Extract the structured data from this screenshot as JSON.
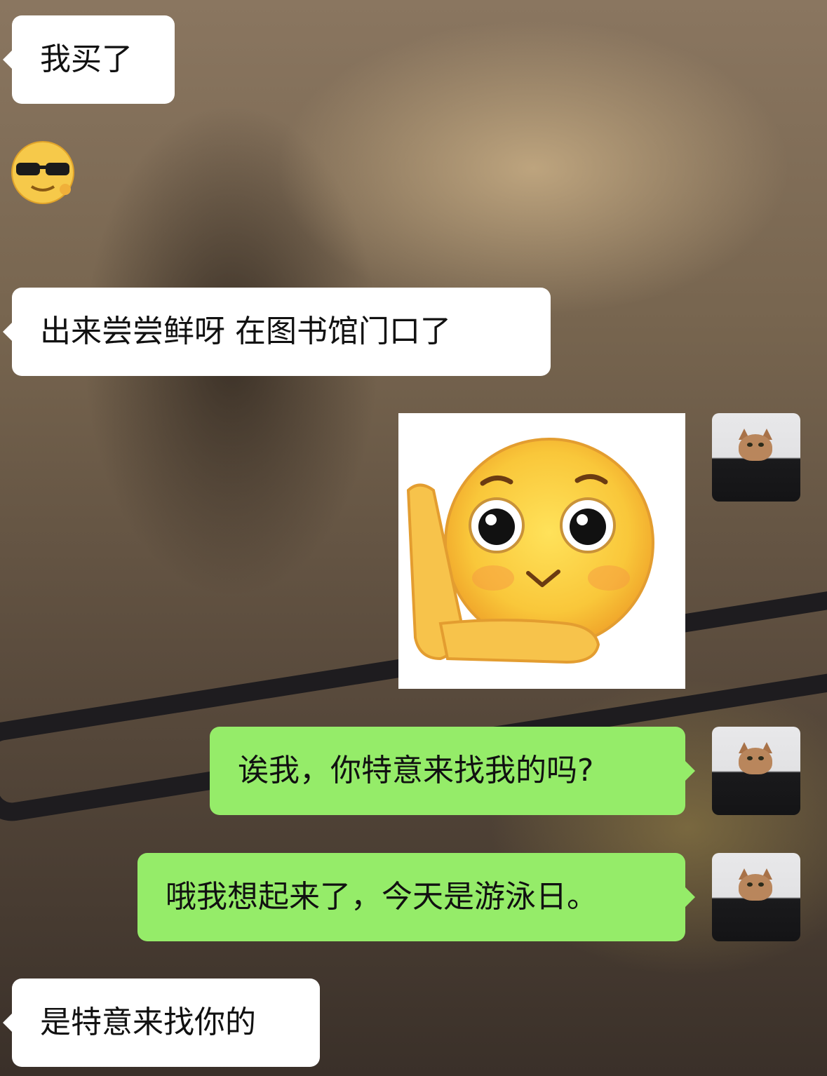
{
  "chat": {
    "messages": [
      {
        "side": "left",
        "type": "text",
        "text": "我买了"
      },
      {
        "side": "left",
        "type": "emoji",
        "emoji": "cool-sunglasses-face-sticker"
      },
      {
        "side": "left",
        "type": "text",
        "text": "出来尝尝鲜呀 在图书馆门口了"
      },
      {
        "side": "right",
        "type": "sticker",
        "emoji": "shy-face-hand-on-cheek-sticker"
      },
      {
        "side": "right",
        "type": "text",
        "text": "诶我，你特意来找我的吗?"
      },
      {
        "side": "right",
        "type": "text",
        "text": "哦我想起来了，今天是游泳日。"
      },
      {
        "side": "left",
        "type": "text",
        "text": "是特意来找你的"
      }
    ],
    "colors": {
      "incoming_bubble": "#ffffff",
      "outgoing_bubble": "#95ec69",
      "text": "#111111"
    },
    "self_avatar": "cat-avatar"
  }
}
